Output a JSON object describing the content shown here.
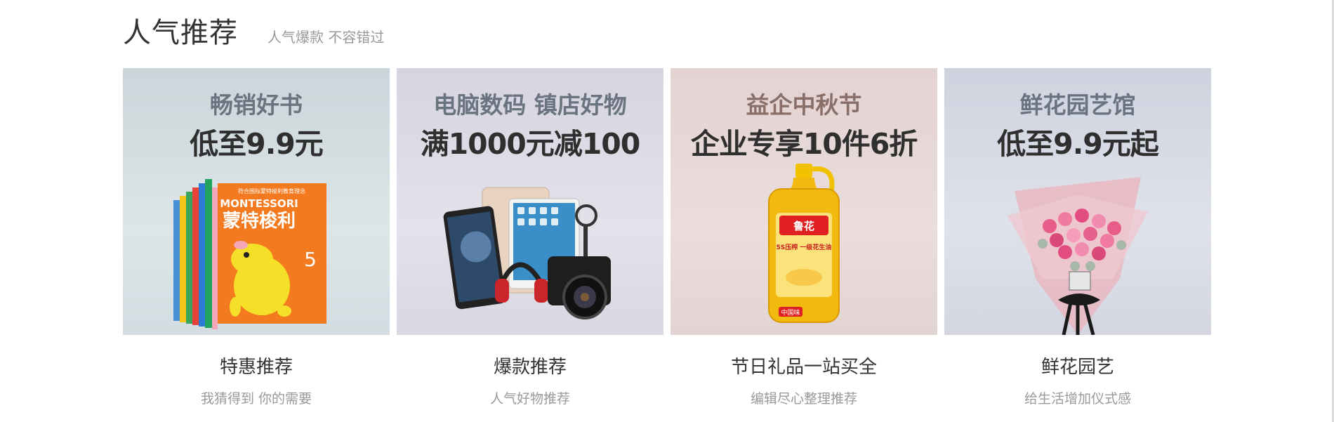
{
  "section": {
    "title": "人气推荐",
    "subtitle": "人气爆款 不容错过"
  },
  "cards": [
    {
      "banner_line1": "畅销好书",
      "banner_line2": "低至9.9元",
      "title": "特惠推荐",
      "subtitle": "我猜得到 你的需要",
      "product_text": {
        "series": "MONTESSORI",
        "name": "蒙特梭利",
        "top": "符合国际蒙特梭利教育理念",
        "side": "5"
      }
    },
    {
      "banner_line1": "电脑数码 镇店好物",
      "banner_line2": "满1000元减100",
      "title": "爆款推荐",
      "subtitle": "人气好物推荐"
    },
    {
      "banner_line1": "益企中秋节",
      "banner_line2": "企业专享10件6折",
      "title": "节日礼品一站买全",
      "subtitle": "编辑尽心整理推荐",
      "product_text": {
        "brand": "鲁花",
        "label": "5S压榨 一级花生油",
        "badge": "中国味"
      }
    },
    {
      "banner_line1": "鲜花园艺馆",
      "banner_line2": "低至9.9元起",
      "title": "鲜花园艺",
      "subtitle": "给生活增加仪式感"
    }
  ],
  "colors": {
    "title": "#333333",
    "subtitle": "#999999",
    "book_orange": "#f47a1f",
    "oil_yellow": "#f2b90f"
  }
}
